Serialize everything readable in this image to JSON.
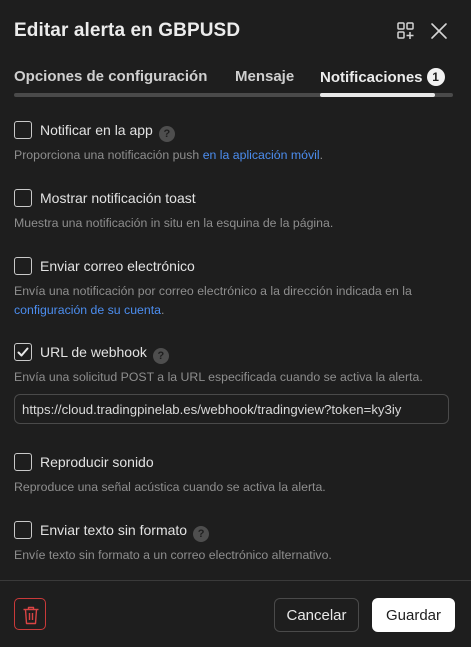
{
  "dialog": {
    "title": "Editar alerta en GBPUSD"
  },
  "icons": {
    "add_widget": "add-widget-icon",
    "close": "close-icon",
    "help": "help-icon",
    "check": "check-icon",
    "trash": "trash-icon"
  },
  "tabs": [
    {
      "label": "Opciones de configuración"
    },
    {
      "label": "Mensaje"
    },
    {
      "label": "Notificaciones",
      "badge": "1",
      "active": true
    }
  ],
  "options": {
    "app": {
      "label": "Notificar en la app",
      "checked": false,
      "desc_text": "Proporciona una notificación push ",
      "desc_link": "en la aplicación móvil",
      "desc_tail": "."
    },
    "toast": {
      "label": "Mostrar notificación toast",
      "checked": false,
      "desc": "Muestra una notificación in situ en la esquina de la página."
    },
    "email": {
      "label": "Enviar correo electrónico",
      "checked": false,
      "desc_text": "Envía una notificación por correo electrónico a la dirección indicada en la",
      "desc_link": "configuración de su cuenta",
      "desc_tail": "."
    },
    "webhook": {
      "label": "URL de webhook",
      "checked": true,
      "desc": "Envía una solicitud POST a la URL especificada cuando se activa la alerta.",
      "url_value": "https://cloud.tradingpinelab.es/webhook/tradingview?token=ky3iy"
    },
    "sound": {
      "label": "Reproducir sonido",
      "checked": false,
      "desc": "Reproduce una señal acústica cuando se activa la alerta."
    },
    "plain": {
      "label": "Enviar texto sin formato",
      "checked": false,
      "desc": "Envíe texto sin formato a un correo electrónico alternativo."
    }
  },
  "footer": {
    "cancel_label": "Cancelar",
    "save_label": "Guardar"
  },
  "colors": {
    "background": "#1e1e1e",
    "link": "#4c8ef0",
    "danger": "#c93a3a",
    "primary_button": "#ffffff"
  }
}
